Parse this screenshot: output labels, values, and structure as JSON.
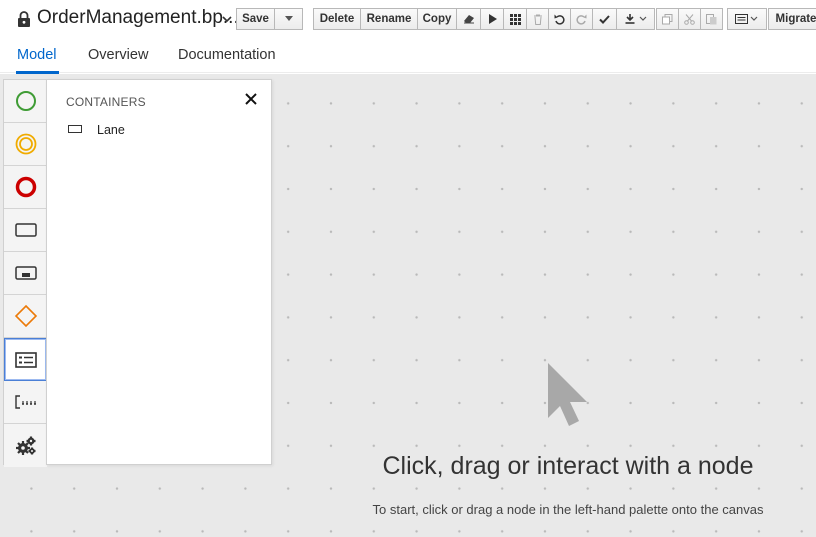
{
  "header": {
    "title": "OrderManagement.bp...",
    "save_label": "Save",
    "delete_label": "Delete",
    "rename_label": "Rename",
    "copy_label": "Copy",
    "migrate_label": "Migrate"
  },
  "tabs": [
    {
      "label": "Model",
      "active": true
    },
    {
      "label": "Overview",
      "active": false
    },
    {
      "label": "Documentation",
      "active": false
    }
  ],
  "palette": {
    "items": [
      {
        "name": "start-events",
        "icon": "start-event-icon",
        "color": "#3f9c35"
      },
      {
        "name": "intermediate-events",
        "icon": "intermediate-event-icon",
        "color": "#f0ab00"
      },
      {
        "name": "end-events",
        "icon": "end-event-icon",
        "color": "#cc0000"
      },
      {
        "name": "activities",
        "icon": "task-icon",
        "color": "#333333"
      },
      {
        "name": "subprocesses",
        "icon": "subprocess-icon",
        "color": "#333333"
      },
      {
        "name": "gateways",
        "icon": "gateway-icon",
        "color": "#ec7a08"
      },
      {
        "name": "containers",
        "icon": "container-icon",
        "color": "#333333",
        "active": true
      },
      {
        "name": "artifacts",
        "icon": "annotation-icon",
        "color": "#333333"
      },
      {
        "name": "custom-tasks",
        "icon": "gears-icon",
        "color": "#333333"
      }
    ]
  },
  "flyout": {
    "title": "CONTAINERS",
    "items": [
      {
        "label": "Lane",
        "icon": "lane-icon"
      }
    ]
  },
  "canvas": {
    "empty_title": "Click, drag or interact with a node",
    "empty_subtitle": "To start, click or drag a node in the left-hand palette onto the canvas"
  },
  "colors": {
    "accent": "#0066cc",
    "canvas_bg": "#e9e9e9"
  }
}
